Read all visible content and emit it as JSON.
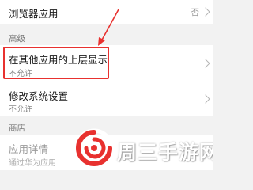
{
  "rows": {
    "browser_app": {
      "title": "浏览器应用",
      "value": "否"
    },
    "overlay": {
      "title": "在其他应用的上层显示",
      "subtitle": "不允许"
    },
    "modify_settings": {
      "title": "修改系统设置",
      "subtitle": "不允许"
    },
    "app_details": {
      "title": "应用详情",
      "subtitle": "通过华为应用"
    }
  },
  "sections": {
    "advanced": "高级",
    "store": "商店"
  },
  "watermark": {
    "text": "周三手游网"
  },
  "colors": {
    "highlight": "#e8312f",
    "watermark_logo": "#e8312f"
  }
}
